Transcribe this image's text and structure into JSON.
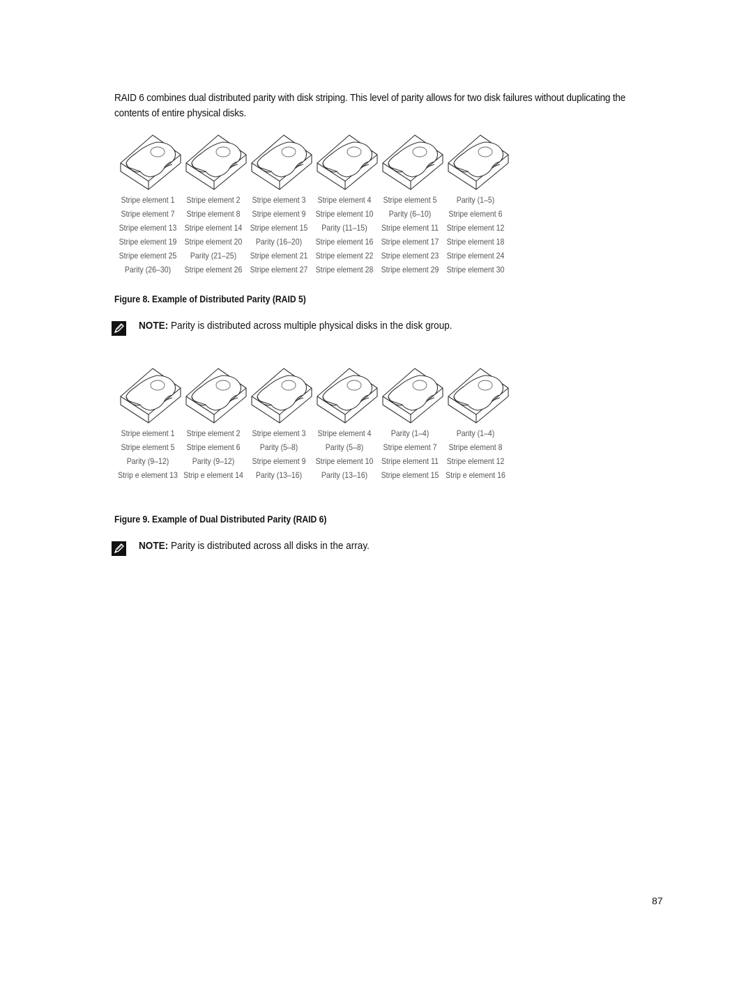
{
  "intro_text": "RAID 6 combines dual distributed parity with disk striping. This level of parity allows for two disk failures without duplicating the contents of entire physical disks.",
  "figure8": {
    "caption": "Figure 8. Example of Distributed Parity (RAID 5)",
    "disk_icon": "hard-disk-icon",
    "disk_count": 6,
    "rows": [
      [
        "Stripe element 1",
        "Stripe element 2",
        "Stripe element 3",
        "Stripe element 4",
        "Stripe element 5",
        "Parity (1–5)"
      ],
      [
        "Stripe element 7",
        "Stripe element 8",
        "Stripe element 9",
        "Stripe element 10",
        "Parity (6–10)",
        "Stripe element 6"
      ],
      [
        "Stripe element 13",
        "Stripe element 14",
        "Stripe element 15",
        "Parity (11–15)",
        "Stripe element 11",
        "Stripe element 12"
      ],
      [
        "Stripe element 19",
        "Stripe element 20",
        "Parity (16–20)",
        "Stripe element 16",
        "Stripe element 17",
        "Stripe element 18"
      ],
      [
        "Stripe element 25",
        "Parity (21–25)",
        "Stripe element 21",
        "Stripe element 22",
        "Stripe element 23",
        "Stripe element 24"
      ],
      [
        "Parity (26–30)",
        "Stripe element 26",
        "Stripe element 27",
        "Stripe element 28",
        "Stripe element 29",
        "Stripe element 30"
      ]
    ]
  },
  "note1": {
    "icon": "pencil-note-icon",
    "label": "NOTE:",
    "text": " Parity is distributed across multiple physical disks in the disk group."
  },
  "figure9": {
    "caption": "Figure 9. Example of Dual Distributed Parity (RAID 6)",
    "disk_icon": "hard-disk-icon",
    "disk_count": 6,
    "rows": [
      [
        "Stripe element 1",
        "Stripe element 2",
        "Stripe element 3",
        "Stripe element 4",
        "Parity (1–4)",
        "Parity (1–4)"
      ],
      [
        "Stripe element 5",
        "Stripe element 6",
        "Parity (5–8)",
        "Parity (5–8)",
        "Stripe element 7",
        "Stripe element 8"
      ],
      [
        "Parity (9–12)",
        "Parity (9–12)",
        "Stripe element 9",
        "Stripe element 10",
        "Stripe element 11",
        "Stripe element 12"
      ],
      [
        "Strip e element 13",
        "Strip e element 14",
        "Parity (13–16)",
        "Parity (13–16)",
        "Stripe element 15",
        "Strip e element 16"
      ]
    ]
  },
  "note2": {
    "icon": "pencil-note-icon",
    "label": "NOTE:",
    "text": " Parity is distributed across all disks in the array."
  },
  "page_number": "87"
}
